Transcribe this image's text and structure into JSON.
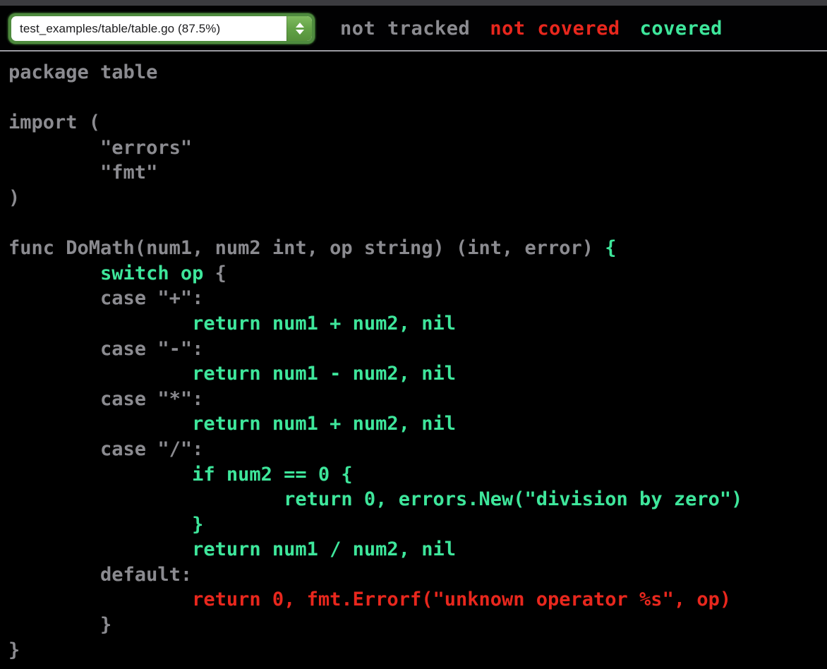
{
  "window": {
    "title_strip_color": "#3b3b3f"
  },
  "header": {
    "file_select": {
      "selected_label": "test_examples/table/table.go (87.5%)",
      "stepper_up_icon": "chevron-up-icon",
      "stepper_down_icon": "chevron-down-icon",
      "focus_ring_color": "#4e8a3e"
    },
    "legend": [
      {
        "label": "not tracked",
        "color": "#8b8b90",
        "key": "not_tracked"
      },
      {
        "label": "not covered",
        "color": "#e8271d",
        "key": "not_covered"
      },
      {
        "label": "covered",
        "color": "#3ee69b",
        "key": "covered"
      }
    ]
  },
  "code": {
    "language": "go",
    "lines": [
      {
        "segments": [
          {
            "text": "package table",
            "cov": "not_tracked"
          }
        ]
      },
      {
        "segments": [
          {
            "text": "",
            "cov": "not_tracked"
          }
        ]
      },
      {
        "segments": [
          {
            "text": "import (",
            "cov": "not_tracked"
          }
        ]
      },
      {
        "segments": [
          {
            "text": "        \"errors\"",
            "cov": "not_tracked"
          }
        ]
      },
      {
        "segments": [
          {
            "text": "        \"fmt\"",
            "cov": "not_tracked"
          }
        ]
      },
      {
        "segments": [
          {
            "text": ")",
            "cov": "not_tracked"
          }
        ]
      },
      {
        "segments": [
          {
            "text": "",
            "cov": "not_tracked"
          }
        ]
      },
      {
        "segments": [
          {
            "text": "func DoMath(num1, num2 int, op string) (int, error) ",
            "cov": "not_tracked"
          },
          {
            "text": "{",
            "cov": "covered"
          }
        ]
      },
      {
        "segments": [
          {
            "text": "        ",
            "cov": "not_tracked"
          },
          {
            "text": "switch op",
            "cov": "covered"
          },
          {
            "text": " {",
            "cov": "not_tracked"
          }
        ]
      },
      {
        "segments": [
          {
            "text": "        case \"+\":",
            "cov": "not_tracked"
          }
        ]
      },
      {
        "segments": [
          {
            "text": "                ",
            "cov": "not_tracked"
          },
          {
            "text": "return num1 + num2, nil",
            "cov": "covered"
          }
        ]
      },
      {
        "segments": [
          {
            "text": "        case \"-\":",
            "cov": "not_tracked"
          }
        ]
      },
      {
        "segments": [
          {
            "text": "                ",
            "cov": "not_tracked"
          },
          {
            "text": "return num1 - num2, nil",
            "cov": "covered"
          }
        ]
      },
      {
        "segments": [
          {
            "text": "        case \"*\":",
            "cov": "not_tracked"
          }
        ]
      },
      {
        "segments": [
          {
            "text": "                ",
            "cov": "not_tracked"
          },
          {
            "text": "return num1 + num2, nil",
            "cov": "covered"
          }
        ]
      },
      {
        "segments": [
          {
            "text": "        case \"/\":",
            "cov": "not_tracked"
          }
        ]
      },
      {
        "segments": [
          {
            "text": "                ",
            "cov": "not_tracked"
          },
          {
            "text": "if num2 == 0 {",
            "cov": "covered"
          }
        ]
      },
      {
        "segments": [
          {
            "text": "                        ",
            "cov": "not_tracked"
          },
          {
            "text": "return 0, errors.New(\"division by zero\")",
            "cov": "covered"
          }
        ]
      },
      {
        "segments": [
          {
            "text": "                ",
            "cov": "not_tracked"
          },
          {
            "text": "}",
            "cov": "covered"
          }
        ]
      },
      {
        "segments": [
          {
            "text": "                ",
            "cov": "not_tracked"
          },
          {
            "text": "return num1 / num2, nil",
            "cov": "covered"
          }
        ]
      },
      {
        "segments": [
          {
            "text": "        default:",
            "cov": "not_tracked"
          }
        ]
      },
      {
        "segments": [
          {
            "text": "                ",
            "cov": "not_tracked"
          },
          {
            "text": "return 0, fmt.Errorf(\"unknown operator %s\", op)",
            "cov": "not_covered"
          }
        ]
      },
      {
        "segments": [
          {
            "text": "        }",
            "cov": "not_tracked"
          }
        ]
      },
      {
        "segments": [
          {
            "text": "}",
            "cov": "not_tracked"
          }
        ]
      }
    ]
  }
}
